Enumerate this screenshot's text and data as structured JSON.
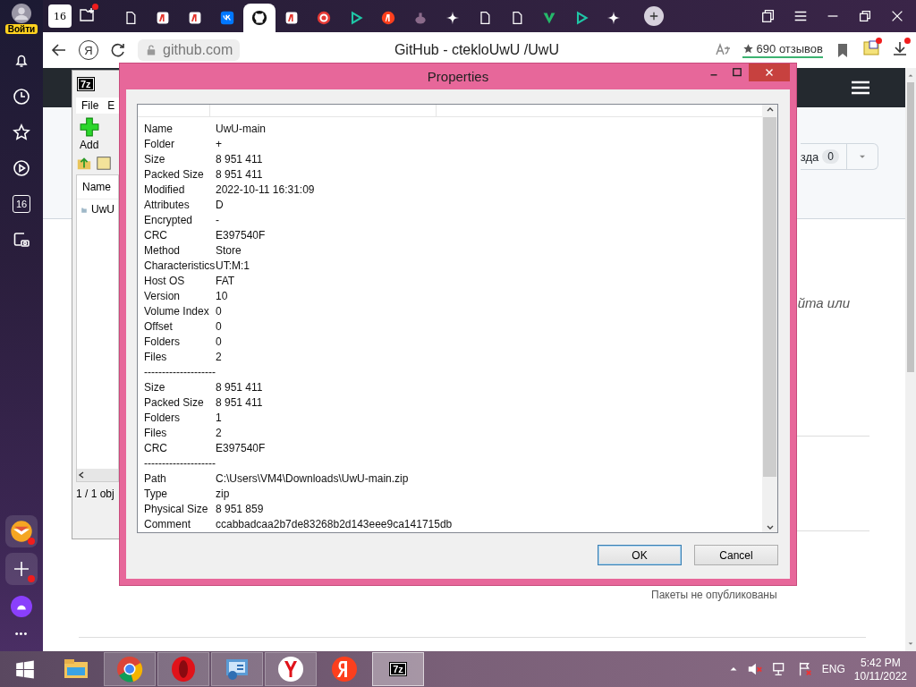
{
  "sidebar": {
    "account_label": "Войти",
    "items": [
      {
        "kind": "bell"
      },
      {
        "kind": "clock"
      },
      {
        "kind": "star"
      },
      {
        "kind": "play"
      },
      {
        "kind": "calendar",
        "text": "16"
      },
      {
        "kind": "camera"
      }
    ],
    "bottom_items": [
      {
        "kind": "mail",
        "badge": true
      },
      {
        "kind": "plus",
        "badge": true
      },
      {
        "kind": "alice",
        "badge": false
      },
      {
        "kind": "more",
        "text": "•••"
      }
    ]
  },
  "tabs": {
    "home_count": "16",
    "items": [
      {
        "kind": "page",
        "selected": false
      },
      {
        "kind": "ya",
        "selected": false
      },
      {
        "kind": "ya",
        "selected": false
      },
      {
        "kind": "vk",
        "selected": false
      },
      {
        "kind": "github",
        "selected": true
      },
      {
        "kind": "ya",
        "selected": false
      },
      {
        "kind": "ring",
        "selected": false
      },
      {
        "kind": "play",
        "selected": false
      },
      {
        "kind": "yacircle",
        "selected": false
      },
      {
        "kind": "blob",
        "selected": false
      },
      {
        "kind": "sparkle",
        "selected": false
      },
      {
        "kind": "page",
        "selected": false
      },
      {
        "kind": "page",
        "selected": false
      },
      {
        "kind": "vee",
        "selected": false
      },
      {
        "kind": "play",
        "selected": false
      },
      {
        "kind": "sparkle",
        "selected": false
      }
    ]
  },
  "address_bar": {
    "yandex_button": "Я",
    "url": "github.com",
    "title": "GitHub - ctekloUwU /UwU",
    "reviews": "690 отзывов"
  },
  "webpage": {
    "star_label": "зда",
    "star_count": "0",
    "italic_text": "йта или",
    "packages_text": "Пакеты не опубликованы"
  },
  "sevenzip_window": {
    "logo": "7z",
    "menu": [
      "File",
      "E"
    ],
    "toolbar": [
      "Add"
    ],
    "column": "Name",
    "items": [
      "UwU"
    ],
    "status": "1 / 1 obj"
  },
  "properties_dialog": {
    "title": "Properties",
    "rows": [
      {
        "kind": "row",
        "name": "Name",
        "value": "UwU-main"
      },
      {
        "kind": "row",
        "name": "Folder",
        "value": "+"
      },
      {
        "kind": "row",
        "name": "Size",
        "value": "8 951 411"
      },
      {
        "kind": "row",
        "name": "Packed Size",
        "value": "8 951 411"
      },
      {
        "kind": "row",
        "name": "Modified",
        "value": "2022-10-11 16:31:09"
      },
      {
        "kind": "row",
        "name": "Attributes",
        "value": "D"
      },
      {
        "kind": "row",
        "name": "Encrypted",
        "value": "-"
      },
      {
        "kind": "row",
        "name": "CRC",
        "value": "E397540F"
      },
      {
        "kind": "row",
        "name": "Method",
        "value": "Store"
      },
      {
        "kind": "row",
        "name": "Characteristics",
        "value": "UT:M:1"
      },
      {
        "kind": "row",
        "name": "Host OS",
        "value": "FAT"
      },
      {
        "kind": "row",
        "name": "Version",
        "value": "10"
      },
      {
        "kind": "row",
        "name": "Volume Index",
        "value": "0"
      },
      {
        "kind": "row",
        "name": "Offset",
        "value": "0"
      },
      {
        "kind": "row",
        "name": "Folders",
        "value": "0"
      },
      {
        "kind": "row",
        "name": "Files",
        "value": "2"
      },
      {
        "kind": "separator",
        "text": "--------------------"
      },
      {
        "kind": "row",
        "name": "Size",
        "value": "8 951 411"
      },
      {
        "kind": "row",
        "name": "Packed Size",
        "value": "8 951 411"
      },
      {
        "kind": "row",
        "name": "Folders",
        "value": "1"
      },
      {
        "kind": "row",
        "name": "Files",
        "value": "2"
      },
      {
        "kind": "row",
        "name": "CRC",
        "value": "E397540F"
      },
      {
        "kind": "separator",
        "text": "--------------------"
      },
      {
        "kind": "row",
        "name": "Path",
        "value": "C:\\Users\\VM4\\Downloads\\UwU-main.zip"
      },
      {
        "kind": "row",
        "name": "Type",
        "value": "zip"
      },
      {
        "kind": "row",
        "name": "Physical Size",
        "value": "8 951 859"
      },
      {
        "kind": "row",
        "name": "Comment",
        "value": "ccabbadcaa2b7de83268b2d143eee9ca141715db"
      }
    ],
    "buttons": [
      {
        "label": "OK",
        "default": true
      },
      {
        "label": "Cancel",
        "default": false
      }
    ]
  },
  "taskbar": {
    "apps": [
      {
        "kind": "explorer",
        "running": false,
        "selected": false
      },
      {
        "kind": "chrome",
        "running": true,
        "selected": false
      },
      {
        "kind": "opera",
        "running": true,
        "selected": false
      },
      {
        "kind": "panel",
        "running": true,
        "selected": false
      },
      {
        "kind": "ybrowser",
        "running": true,
        "selected": false
      },
      {
        "kind": "ya",
        "running": false,
        "selected": false
      },
      {
        "kind": "sevenzip",
        "text": "7z",
        "running": true,
        "selected": true
      }
    ],
    "language": "ENG",
    "time": "5:42 PM",
    "date": "10/11/2022"
  }
}
